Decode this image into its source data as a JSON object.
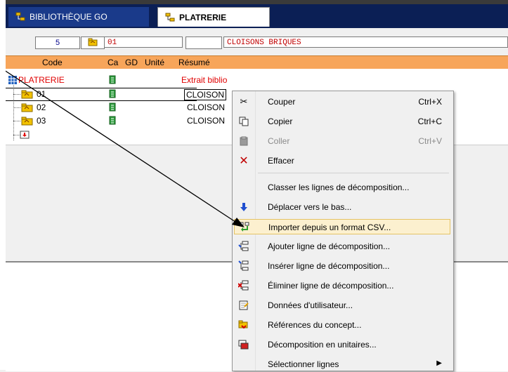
{
  "tabs": [
    {
      "label": "BIBLIOTHÈQUE GO"
    },
    {
      "label": "PLATRERIE"
    }
  ],
  "code_row": {
    "number": "5",
    "code": "01",
    "description": "CLOISONS BRIQUES"
  },
  "grid_header": {
    "code": "Code",
    "ca": "Ca",
    "gd": "GD",
    "unite": "Unité",
    "resume": "Résumé"
  },
  "tree": {
    "root": {
      "code": "PLATRERIE",
      "resume": "Extrait biblio"
    },
    "children": [
      {
        "code": "01",
        "resume": "CLOISON"
      },
      {
        "code": "02",
        "resume": "CLOISON"
      },
      {
        "code": "03",
        "resume": "CLOISON"
      }
    ]
  },
  "colors": {
    "tab_bar": "#0b1f55",
    "header": "#f7a55a",
    "red_text": "#c00000",
    "menu_highlight": "#fcf0cf"
  },
  "menu": {
    "items": [
      {
        "label": "Couper",
        "shortcut": "Ctrl+X",
        "icon": "scissors-icon"
      },
      {
        "label": "Copier",
        "shortcut": "Ctrl+C",
        "icon": "copy-icon"
      },
      {
        "label": "Coller",
        "shortcut": "Ctrl+V",
        "icon": "paste-icon"
      },
      {
        "label": "Effacer",
        "shortcut": "",
        "icon": "delete-x-icon"
      },
      {
        "label": "Classer les lignes de décomposition...",
        "shortcut": "",
        "icon": ""
      },
      {
        "label": "Déplacer vers le bas...",
        "shortcut": "",
        "icon": "arrow-down-icon"
      },
      {
        "label": "Importer depuis un format CSV...",
        "shortcut": "",
        "icon": "import-csv-icon"
      },
      {
        "label": "Ajouter ligne de décomposition...",
        "shortcut": "",
        "icon": "add-line-icon"
      },
      {
        "label": "Insérer ligne de décomposition...",
        "shortcut": "",
        "icon": "insert-line-icon"
      },
      {
        "label": "Éliminer ligne de décomposition...",
        "shortcut": "",
        "icon": "remove-line-icon"
      },
      {
        "label": "Données d'utilisateur...",
        "shortcut": "",
        "icon": "user-data-icon"
      },
      {
        "label": "Références du concept...",
        "shortcut": "",
        "icon": "references-icon"
      },
      {
        "label": "Décomposition en unitaires...",
        "shortcut": "",
        "icon": "decomposition-icon"
      },
      {
        "label": "Sélectionner lignes",
        "shortcut": "",
        "icon": ""
      }
    ]
  }
}
